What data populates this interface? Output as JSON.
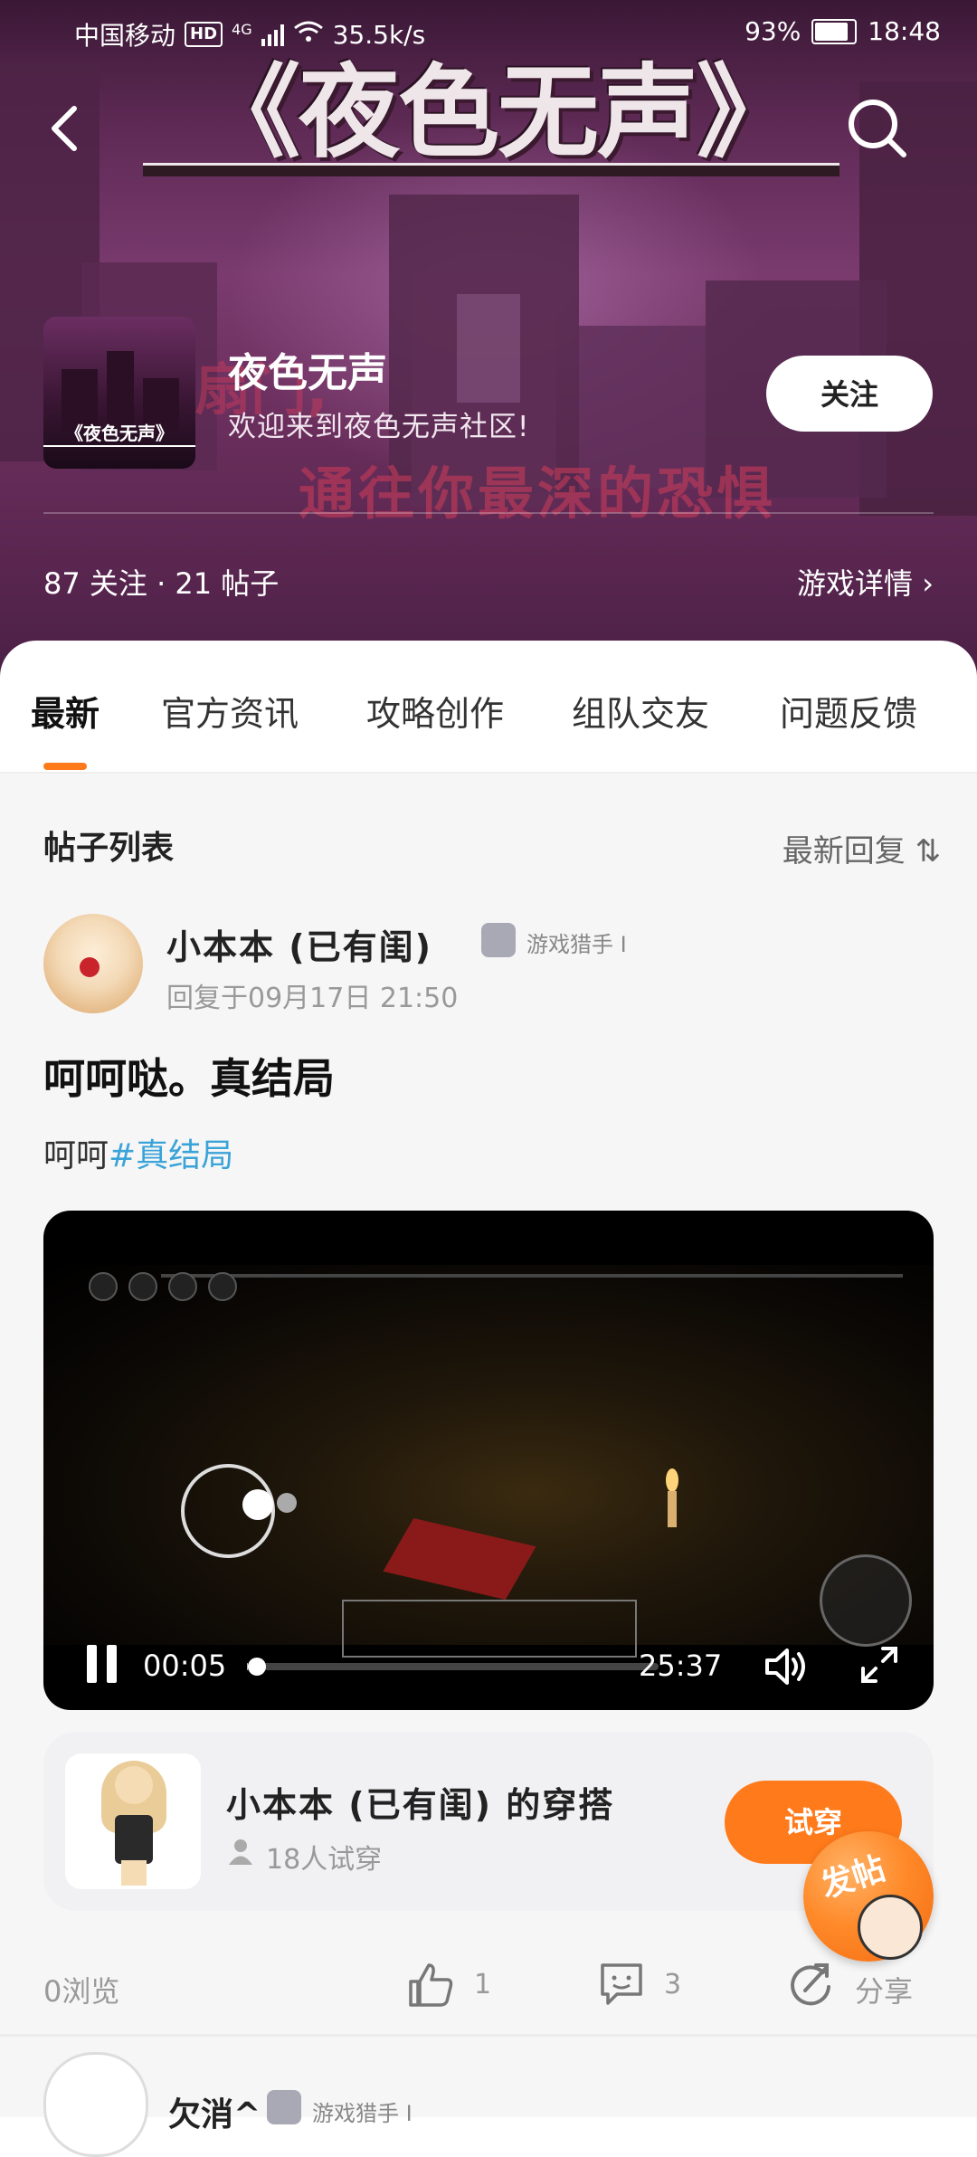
{
  "status_bar": {
    "carrier": "中国移动",
    "hd": "HD",
    "net": "4G",
    "speed": "35.5k/s",
    "battery": "93%",
    "time": "18:48"
  },
  "header": {
    "logo_text": "《夜色无声》",
    "thumb_label": "《夜色无声》",
    "game_name": "夜色无声",
    "welcome": "欢迎来到夜色无声社区!",
    "watermark_line1": "扇门,",
    "watermark_line2": "通往你最深的恐惧",
    "follow_label": "关注",
    "stats": "87 关注 · 21 帖子",
    "details_link": "游戏详情 ›"
  },
  "tabs": [
    {
      "label": "最新",
      "active": true
    },
    {
      "label": "官方资讯",
      "active": false
    },
    {
      "label": "攻略创作",
      "active": false
    },
    {
      "label": "组队交友",
      "active": false
    },
    {
      "label": "问题反馈",
      "active": false
    }
  ],
  "list": {
    "header": "帖子列表",
    "sort_label": "最新回复 ⇅"
  },
  "post": {
    "author": "小本本 (已有闺)",
    "rank": "游戏猎手 I",
    "reply_time": "回复于09月17日 21:50",
    "title": "呵呵哒。真结局",
    "body_text": "呵呵",
    "body_tag": "#真结局",
    "video": {
      "current_time": "00:05",
      "total_time": "25:37",
      "progress_fraction": 0.003
    },
    "outfit": {
      "title": "小本本 (已有闺) 的穿搭",
      "tries": "18人试穿",
      "try_label": "试穿"
    },
    "views": "0浏览",
    "likes": "1",
    "comments": "3",
    "share_label": "分享"
  },
  "fab": {
    "label": "发帖"
  },
  "next_post": {
    "author": "欠消^",
    "rank": "游戏猎手 I"
  },
  "colors": {
    "accent": "#ff7a1a",
    "tag": "#3aa3d8",
    "header_bg": "#6a2e5c"
  },
  "icons": [
    "back-arrow-icon",
    "search-icon",
    "pause-icon",
    "volume-icon",
    "fullscreen-icon",
    "thumb-up-icon",
    "comment-icon",
    "share-icon",
    "user-icon",
    "chevron-right-icon"
  ]
}
